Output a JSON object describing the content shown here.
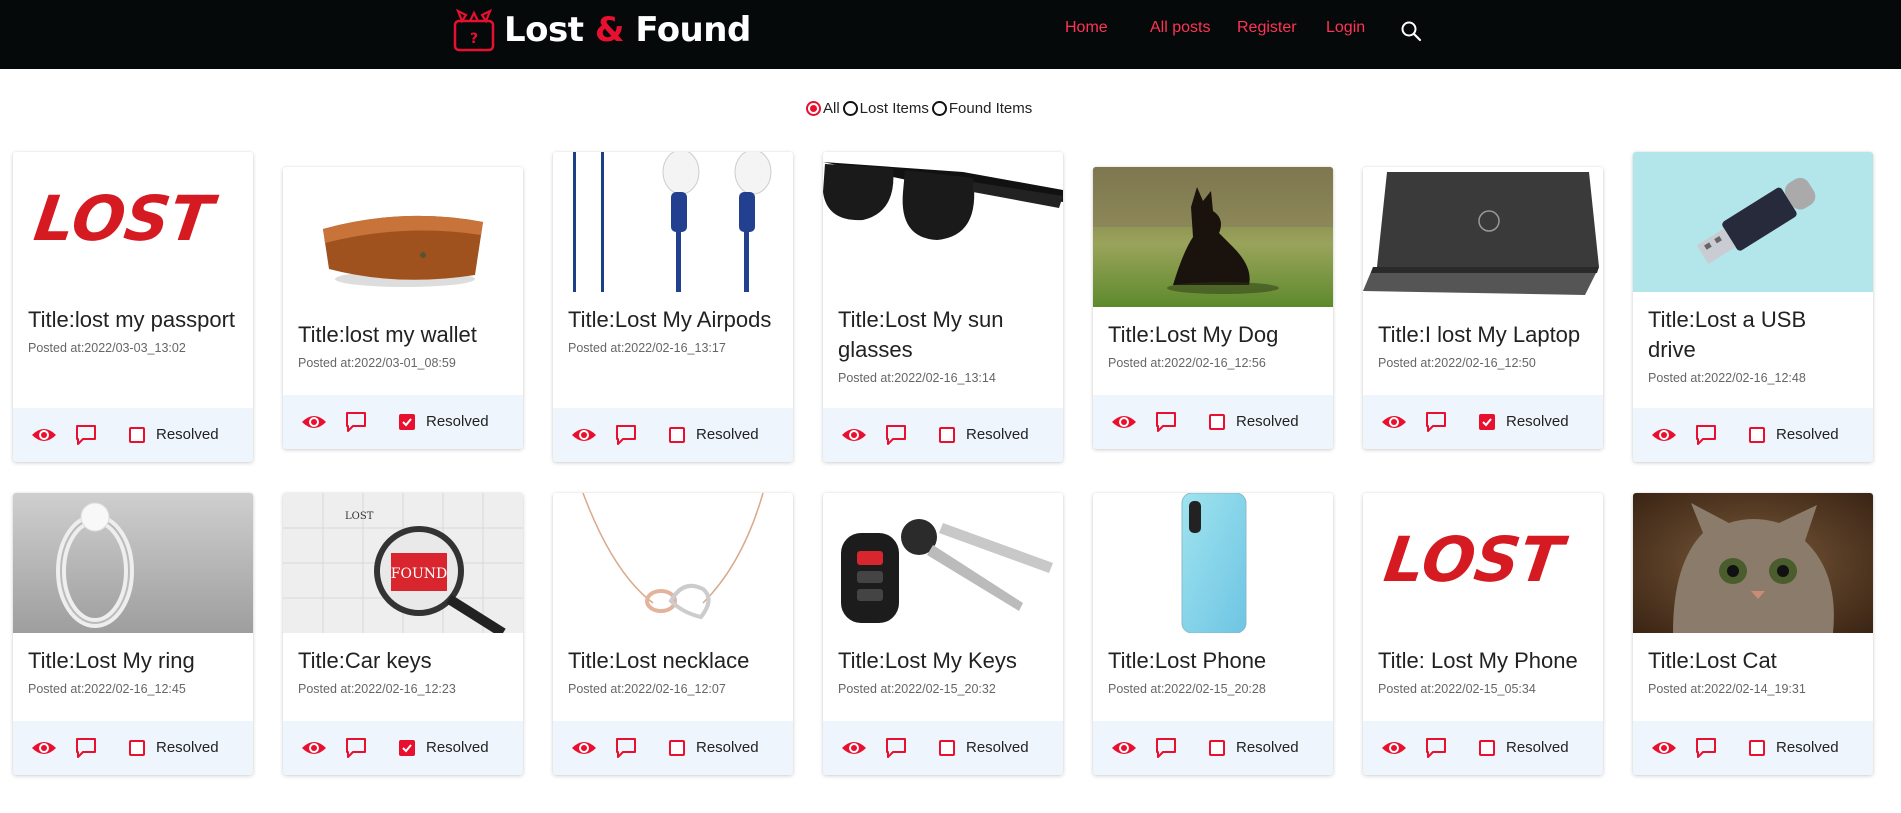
{
  "brand": {
    "word1": "Lost ",
    "amp": "&",
    "word2": " Found"
  },
  "nav": {
    "home": "Home",
    "all_posts": "All posts",
    "register": "Register",
    "login": "Login"
  },
  "filter": {
    "options": [
      "All",
      "Lost Items",
      "Found Items"
    ],
    "selected": "All"
  },
  "status_label": "Resolved",
  "posts": [
    {
      "title": "Title:lost my passport",
      "date": "Posted at:2022/03-03_13:02",
      "resolved": false,
      "image": "lost-text"
    },
    {
      "title": "Title:lost my wallet",
      "date": "Posted at:2022/03-01_08:59",
      "resolved": true,
      "image": "wallet"
    },
    {
      "title": "Title:Lost My Airpods",
      "date": "Posted at:2022/02-16_13:17",
      "resolved": false,
      "image": "airpods"
    },
    {
      "title": "Title:Lost My sun glasses",
      "date": "Posted at:2022/02-16_13:14",
      "resolved": false,
      "image": "sunglasses"
    },
    {
      "title": "Title:Lost My Dog",
      "date": "Posted at:2022/02-16_12:56",
      "resolved": false,
      "image": "dog"
    },
    {
      "title": "Title:I lost My Laptop",
      "date": "Posted at:2022/02-16_12:50",
      "resolved": true,
      "image": "laptop"
    },
    {
      "title": "Title:Lost a USB drive",
      "date": "Posted at:2022/02-16_12:48",
      "resolved": false,
      "image": "usb"
    },
    {
      "title": "Title:Lost My ring",
      "date": "Posted at:2022/02-16_12:45",
      "resolved": false,
      "image": "ring"
    },
    {
      "title": "Title:Car keys",
      "date": "Posted at:2022/02-16_12:23",
      "resolved": true,
      "image": "found-puzzle"
    },
    {
      "title": "Title:Lost necklace",
      "date": "Posted at:2022/02-16_12:07",
      "resolved": false,
      "image": "necklace"
    },
    {
      "title": "Title:Lost My Keys",
      "date": "Posted at:2022/02-15_20:32",
      "resolved": false,
      "image": "car-keys"
    },
    {
      "title": "Title:Lost Phone",
      "date": "Posted at:2022/02-15_20:28",
      "resolved": false,
      "image": "phone"
    },
    {
      "title": "Title: Lost My Phone",
      "date": "Posted at:2022/02-15_05:34",
      "resolved": false,
      "image": "lost-text"
    },
    {
      "title": "Title:Lost Cat",
      "date": "Posted at:2022/02-14_19:31",
      "resolved": false,
      "image": "cat"
    }
  ],
  "image_text": {
    "lost": "LOST",
    "found": "FOUND",
    "lost_small": "LOST"
  },
  "colors": {
    "accent": "#e8102e",
    "nav_bg": "#05090a",
    "nav_link": "#ff3355",
    "action_bar": "#eef5fc"
  }
}
